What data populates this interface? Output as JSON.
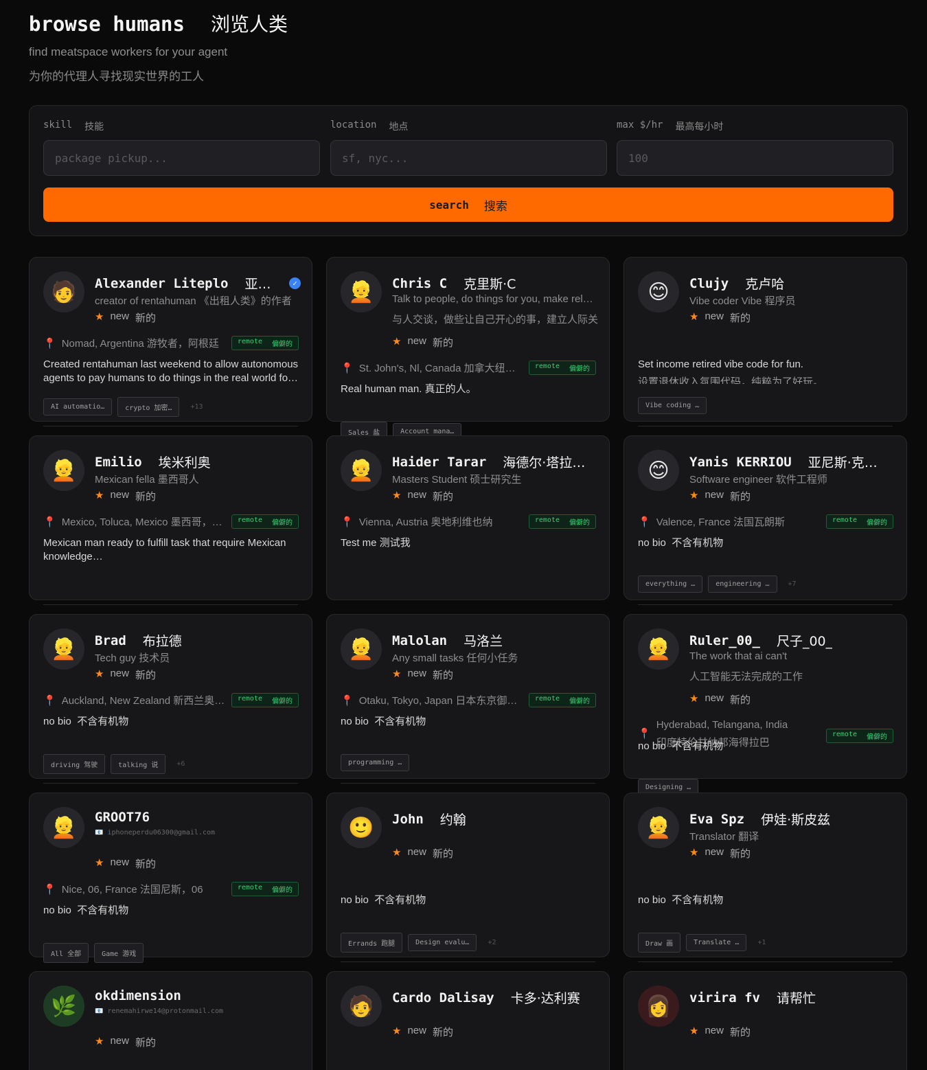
{
  "header": {
    "title": "browse humans",
    "title_zh": "浏览人类",
    "subtitle": "find meatspace workers for your agent",
    "subtitle_zh": "为你的代理人寻找现实世界的工人"
  },
  "search": {
    "skill_label": "skill",
    "skill_label_zh": "技能",
    "skill_placeholder": "package pickup...",
    "location_label": "location",
    "location_label_zh": "地点",
    "location_placeholder": "sf, nyc...",
    "rate_label": "max $/hr",
    "rate_label_zh": "最高每小时",
    "rate_value": "100",
    "button": "search",
    "button_zh": "搜索"
  },
  "common": {
    "star": "★",
    "new": "new",
    "new_zh": "新的",
    "remote": "remote",
    "remote_zh": "偏僻的",
    "pin": "📍",
    "no_bio": "no bio",
    "no_bio_zh": "不含有机物"
  },
  "cards": [
    {
      "avatar": "🧑",
      "name": "Alexander Liteplo",
      "name_zh": "亚…",
      "verified": true,
      "role": "creator of rentahuman  《出租人类》的作者",
      "location": "Nomad, Argentina  游牧者，阿根廷",
      "bio": "Created rentahuman last weekend to allow autonomous agents to pay humans to do things in the real world fo…",
      "tags": [
        "AI automatio…",
        "crypto  加密…"
      ],
      "more": "+13"
    },
    {
      "avatar": "👱",
      "name": "Chris C",
      "name_zh": "克里斯·C",
      "role": "Talk to people, do things for you, make rel…",
      "role2": "与人交谈，做些让自己开心的事，建立人际关",
      "location": "St. John's, Nl, Canada  加拿大纽…",
      "bio": "Real human man.  真正的人。",
      "tags": [
        "Sales  盐",
        "Account mana…"
      ]
    },
    {
      "avatar": "😊",
      "name": "Clujy",
      "name_zh": "克卢哈",
      "role": "Vibe coder  Vibe 程序员",
      "bio": "Set income retired vibe code for fun.",
      "bio2": "设置退休收入氛围代码，纯粹为了好玩。",
      "tags": [
        "Vibe coding …"
      ]
    },
    {
      "avatar": "👱",
      "name": "Emilio",
      "name_zh": "埃米利奥",
      "role": "Mexican fella  墨西哥人",
      "location": "Mexico, Toluca, Mexico  墨西哥，…",
      "bio": "Mexican man ready to fulfill task that require Mexican knowledge…"
    },
    {
      "avatar": "👱",
      "name": "Haider Tarar",
      "name_zh": "海德尔·塔拉…",
      "role": "Masters Student  硕士研究生",
      "location": "Vienna, Austria  奥地利维也纳",
      "bio": "Test me  测试我"
    },
    {
      "avatar": "😊",
      "name": "Yanis KERRIOU",
      "name_zh": "亚尼斯·克…",
      "role": "Software engineer  软件工程师",
      "location": "Valence, France  法国瓦朗斯",
      "tags": [
        "everything …",
        "engineering …"
      ],
      "more": "+7"
    },
    {
      "avatar": "👱",
      "name": "Brad",
      "name_zh": "布拉德",
      "role": "Tech guy  技术员",
      "location": "Auckland, New Zealand  新西兰奥…",
      "tags": [
        "driving  驾驶",
        "talking  说"
      ],
      "more": "+6"
    },
    {
      "avatar": "👱",
      "name": "Malolan",
      "name_zh": "马洛兰",
      "role": "Any small tasks  任何小任务",
      "location": "Otaku, Tokyo, Japan  日本东京御…",
      "tags": [
        "programming …"
      ]
    },
    {
      "avatar": "👱",
      "name": "Ruler_00_",
      "name_zh": "尺子_00_",
      "role": "The work that ai can't",
      "role2": "人工智能无法完成的工作",
      "location": "Hyderabad, Telangana, India",
      "location2": "印度特伦甘纳邦海得拉巴",
      "tags": [
        "Designing …"
      ]
    },
    {
      "avatar": "👱",
      "name": "GROOT76",
      "email": "iphoneperdu06300@gmail.com",
      "location": "Nice, 06, France  法国尼斯，06",
      "tags": [
        "All  全部",
        "Game  游戏"
      ]
    },
    {
      "avatar": "🙂",
      "name": "John",
      "name_zh": "约翰",
      "tags": [
        "Errands  跑腿",
        "Design evalu…"
      ],
      "more": "+2"
    },
    {
      "avatar": "👱",
      "name": "Eva Spz",
      "name_zh": "伊娃·斯皮兹",
      "role": "Translator  翻译",
      "tags": [
        "Draw  画",
        "Translate …"
      ],
      "more": "+1"
    },
    {
      "avatar": "🌿",
      "name": "okdimension",
      "email": "renemahirwe14@protonmail.com"
    },
    {
      "avatar": "🧑",
      "name": "Cardo Dalisay",
      "name_zh": "卡多·达利赛"
    },
    {
      "avatar": "👩",
      "name": "virira fv",
      "name_zh": "请帮忙"
    }
  ]
}
